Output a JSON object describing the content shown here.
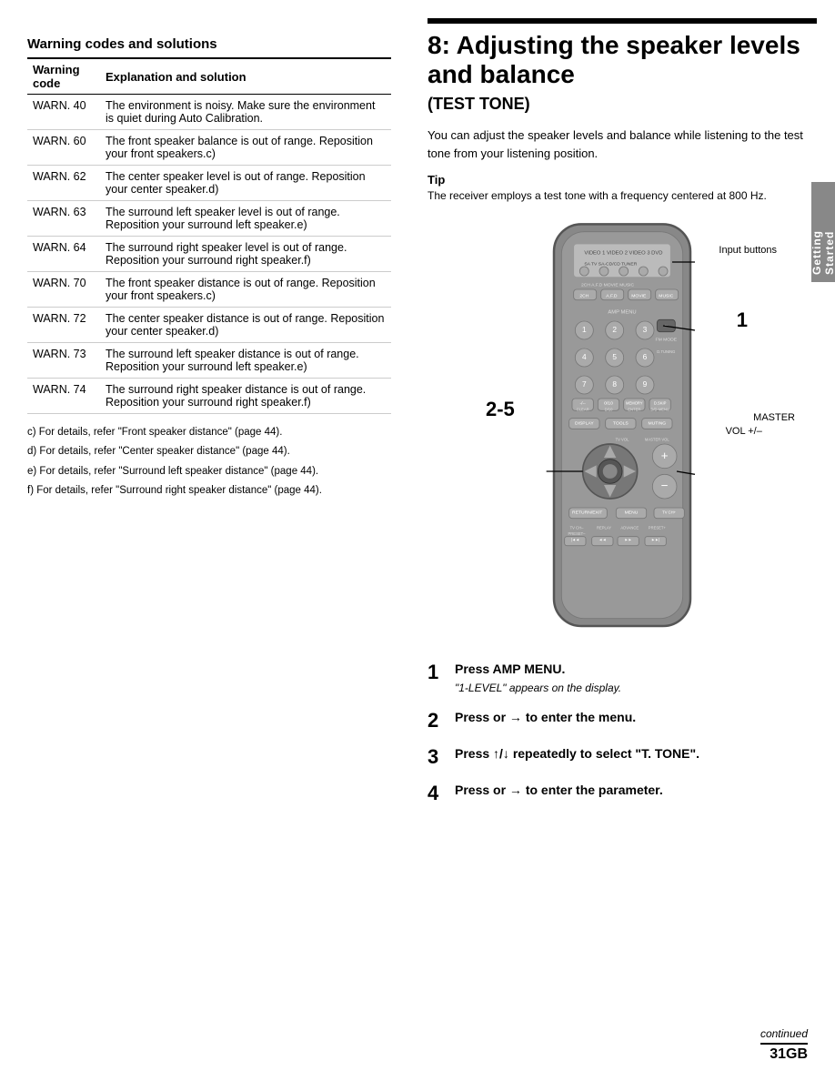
{
  "left": {
    "table_title": "Warning codes and solutions",
    "table_headers": [
      "Warning code",
      "Explanation and solution"
    ],
    "rows": [
      {
        "code": "WARN. 40",
        "explanation": "The environment is noisy. Make sure the environment is quiet during Auto Calibration."
      },
      {
        "code": "WARN. 60",
        "explanation": "The front speaker balance is out of range. Reposition your front speakers.c)"
      },
      {
        "code": "WARN. 62",
        "explanation": "The center speaker level is out of range. Reposition your center speaker.d)"
      },
      {
        "code": "WARN. 63",
        "explanation": "The surround left speaker level is out of range. Reposition your surround left speaker.e)"
      },
      {
        "code": "WARN. 64",
        "explanation": "The surround right speaker level is out of range. Reposition your surround right speaker.f)"
      },
      {
        "code": "WARN. 70",
        "explanation": "The front speaker distance is out of range. Reposition your front speakers.c)"
      },
      {
        "code": "WARN. 72",
        "explanation": "The center speaker distance is out of range. Reposition your center speaker.d)"
      },
      {
        "code": "WARN. 73",
        "explanation": "The surround left speaker distance is out of range. Reposition your surround left speaker.e)"
      },
      {
        "code": "WARN. 74",
        "explanation": "The surround right speaker distance is out of range. Reposition your surround right speaker.f)"
      }
    ],
    "footnotes": [
      "c) For details, refer \"Front speaker distance\" (page 44).",
      "d) For details, refer \"Center speaker distance\" (page 44).",
      "e) For details, refer \"Surround left speaker distance\" (page 44).",
      "f)  For details, refer \"Surround right speaker distance\" (page 44)."
    ]
  },
  "right": {
    "section_number": "8:",
    "section_title": "Adjusting the speaker levels and balance",
    "section_subtitle": "(TEST TONE)",
    "description": "You can adjust the speaker levels and balance while listening to the test tone from your listening position.",
    "tip_label": "Tip",
    "tip_text": "The receiver employs a test tone with a frequency centered at 800 Hz.",
    "callout_input_buttons": "Input\nbuttons",
    "callout_1": "1",
    "callout_2_5": "2-5",
    "callout_master_vol": "MASTER\nVOL +/–",
    "steps": [
      {
        "num": "1",
        "instruction": "Press AMP MENU.",
        "note": "\"1-LEVEL\" appears on the display."
      },
      {
        "num": "2",
        "instruction": "Press  or → to enter the menu.",
        "note": ""
      },
      {
        "num": "3",
        "instruction": "Press ↑/↓ repeatedly to select \"T. TONE\".",
        "note": ""
      },
      {
        "num": "4",
        "instruction": "Press  or → to enter the parameter.",
        "note": ""
      }
    ],
    "sidebar_label": "Getting Started",
    "continued": "continued",
    "page_number": "31GB"
  }
}
